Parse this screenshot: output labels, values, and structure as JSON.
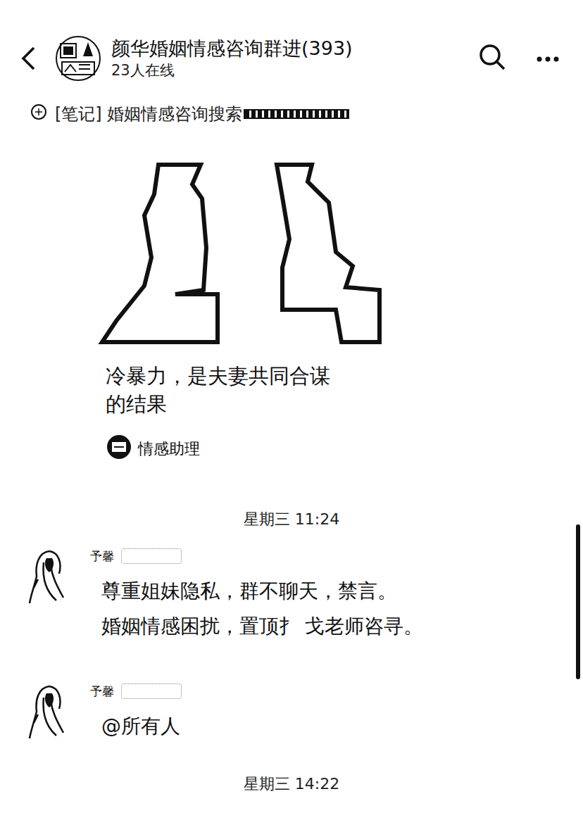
{
  "header": {
    "title": "颜华婚姻情感咨询群进(393)",
    "online": "23人在线"
  },
  "note": {
    "label": "[笔记] 婚姻情感咨询搜索"
  },
  "card": {
    "caption": "冷暴力，是夫妻共同合谋的结果",
    "source": "情感助理"
  },
  "timeline": [
    {
      "kind": "time",
      "text": "星期三 11:24"
    },
    {
      "kind": "message",
      "sender": "予馨",
      "lines": [
        "尊重姐妹隐私，群不聊天，禁言。",
        "婚姻情感困扰，置顶扌 戈老师咨寻。"
      ]
    },
    {
      "kind": "message",
      "sender": "予馨",
      "lines": [
        "@所有人"
      ]
    },
    {
      "kind": "time",
      "text": "星期三 14:22"
    }
  ]
}
